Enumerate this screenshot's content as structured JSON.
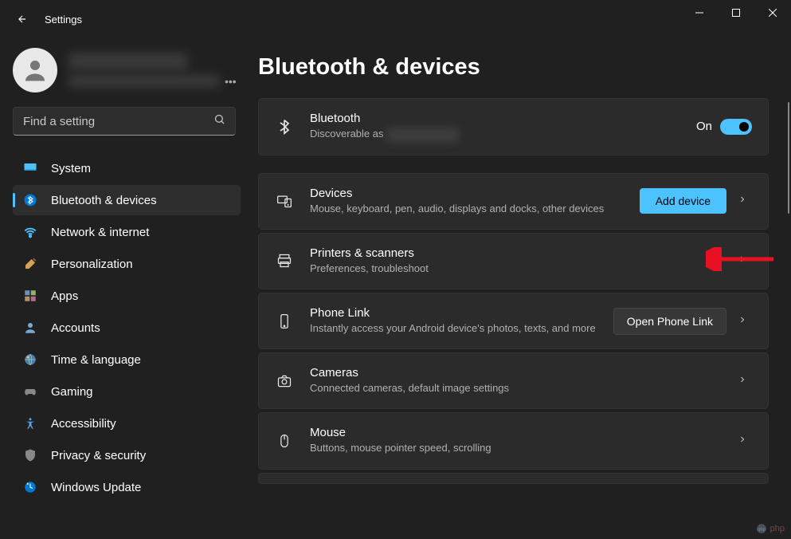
{
  "app_title": "Settings",
  "search": {
    "placeholder": "Find a setting"
  },
  "sidebar": {
    "items": [
      {
        "label": "System",
        "icon": "monitor"
      },
      {
        "label": "Bluetooth & devices",
        "icon": "bluetooth",
        "active": true
      },
      {
        "label": "Network & internet",
        "icon": "wifi"
      },
      {
        "label": "Personalization",
        "icon": "brush"
      },
      {
        "label": "Apps",
        "icon": "apps"
      },
      {
        "label": "Accounts",
        "icon": "person"
      },
      {
        "label": "Time & language",
        "icon": "globe"
      },
      {
        "label": "Gaming",
        "icon": "gamepad"
      },
      {
        "label": "Accessibility",
        "icon": "accessibility"
      },
      {
        "label": "Privacy & security",
        "icon": "shield"
      },
      {
        "label": "Windows Update",
        "icon": "update"
      }
    ]
  },
  "page": {
    "title": "Bluetooth & devices",
    "bluetooth": {
      "title": "Bluetooth",
      "subtitle_prefix": "Discoverable as",
      "toggle_label": "On",
      "toggle_state": true
    },
    "cards": [
      {
        "title": "Devices",
        "subtitle": "Mouse, keyboard, pen, audio, displays and docks, other devices",
        "button": "Add device",
        "button_style": "primary"
      },
      {
        "title": "Printers & scanners",
        "subtitle": "Preferences, troubleshoot"
      },
      {
        "title": "Phone Link",
        "subtitle": "Instantly access your Android device's photos, texts, and more",
        "button": "Open Phone Link",
        "button_style": "secondary"
      },
      {
        "title": "Cameras",
        "subtitle": "Connected cameras, default image settings"
      },
      {
        "title": "Mouse",
        "subtitle": "Buttons, mouse pointer speed, scrolling"
      }
    ]
  },
  "watermark": "php"
}
